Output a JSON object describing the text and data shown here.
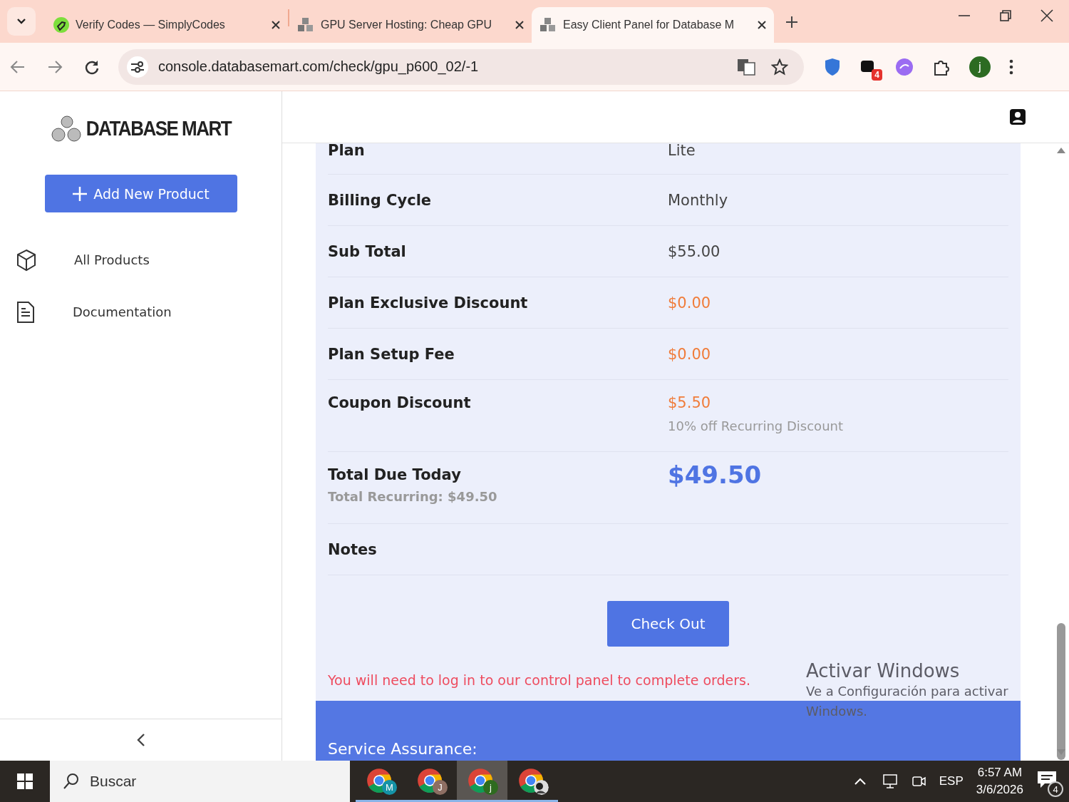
{
  "browser": {
    "tabs": [
      {
        "title": "Verify Codes — SimplyCodes",
        "selected": false
      },
      {
        "title": "GPU Server Hosting: Cheap GPU",
        "selected": false
      },
      {
        "title": "Easy Client Panel for Database M",
        "selected": true
      }
    ],
    "url": "console.databasemart.com/check/gpu_p600_02/-1",
    "extension_badge": "4",
    "profile_initial": "j"
  },
  "sidebar": {
    "logo": "DATABASE MART",
    "add_button": "Add New Product",
    "items": [
      {
        "label": "All Products"
      },
      {
        "label": "Documentation"
      }
    ]
  },
  "order": {
    "rows": [
      {
        "label": "Plan",
        "value": "Lite",
        "kind": "plain"
      },
      {
        "label": "Billing Cycle",
        "value": "Monthly",
        "kind": "plain"
      },
      {
        "label": "Sub Total",
        "value": "$55.00",
        "kind": "plain"
      },
      {
        "label": "Plan Exclusive Discount",
        "value": "$0.00",
        "kind": "discount"
      },
      {
        "label": "Plan Setup Fee",
        "value": "$0.00",
        "kind": "discount"
      },
      {
        "label": "Coupon Discount",
        "value": "$5.50",
        "note": "10% off Recurring Discount",
        "kind": "discount"
      },
      {
        "label": "Total Due Today",
        "sublabel": "Total Recurring: $49.50",
        "value": "$49.50",
        "kind": "total"
      },
      {
        "label": "Notes",
        "kind": "plain"
      }
    ],
    "checkout_button": "Check Out",
    "login_notice": "You will need to log in to our control panel to complete orders.",
    "assurance_title": "Service Assurance:"
  },
  "windows_notice": {
    "title": "Activar Windows",
    "text": "Ve a Configuración para activar Windows."
  },
  "taskbar": {
    "search": "Buscar",
    "apps": [
      {
        "avatar": "M",
        "color": "#1592a6",
        "selected": false
      },
      {
        "avatar": "J",
        "color": "#8d6e63",
        "selected": false
      },
      {
        "avatar": "j",
        "color": "#2e6b1f",
        "selected": true
      },
      {
        "kind": "picture",
        "selected": false
      }
    ],
    "language": "ESP",
    "time": "6:57 AM",
    "date": "3/6/2026",
    "notifications": "4"
  }
}
